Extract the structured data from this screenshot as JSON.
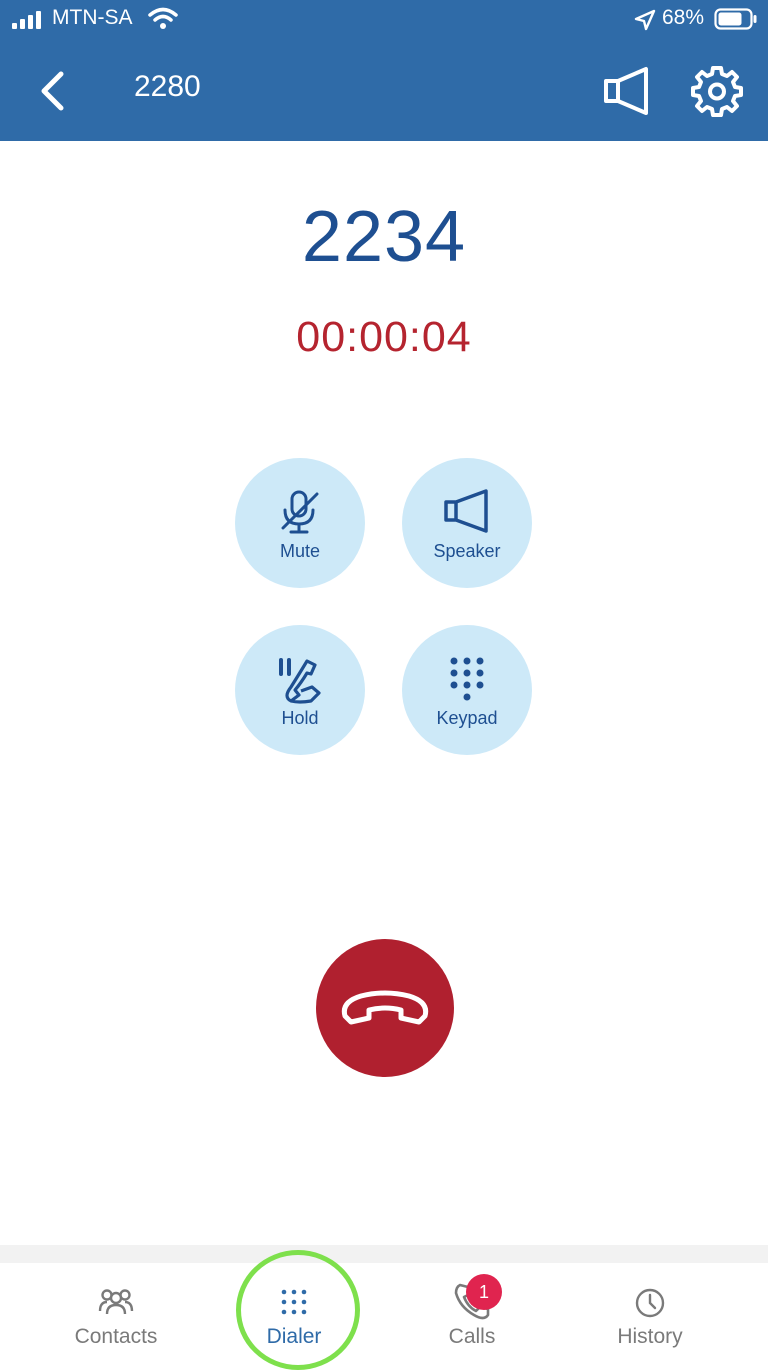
{
  "status_bar": {
    "carrier": "MTN-SA",
    "battery": "68%",
    "battery_level": 0.68,
    "icons": [
      "signal-icon",
      "wifi-icon",
      "location-arrow-icon",
      "battery-icon"
    ]
  },
  "header": {
    "title": "2280",
    "icons": [
      "back-chevron-icon",
      "speaker-icon",
      "gear-icon"
    ]
  },
  "call": {
    "number": "2234",
    "timer": "00:00:04"
  },
  "controls": {
    "mute": "Mute",
    "speaker": "Speaker",
    "hold": "Hold",
    "keypad": "Keypad"
  },
  "end_call": {
    "icon": "hang-up-phone-icon"
  },
  "tabs": {
    "contacts": "Contacts",
    "dialer": "Dialer",
    "calls": "Calls",
    "calls_badge": "1",
    "history": "History",
    "active": "Dialer"
  },
  "colors": {
    "header": "#2f6ba8",
    "number": "#1e4f91",
    "timer": "#b5242f",
    "control_bg": "#cde9f8",
    "end_call": "#b0202f",
    "badge": "#e0244f",
    "highlight": "#7ee04c"
  }
}
